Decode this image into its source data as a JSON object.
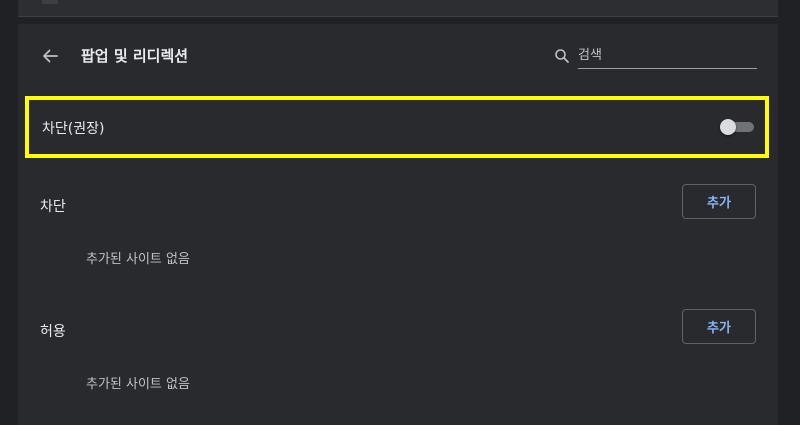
{
  "header": {
    "title": "팝업 및 리디렉션",
    "back_icon": "arrow-left-icon",
    "search": {
      "placeholder": "검색",
      "value": "",
      "icon": "search-icon"
    }
  },
  "block_setting": {
    "label": "차단(권장)",
    "toggle_on": false,
    "highlight_color": "#ffff00"
  },
  "sections": [
    {
      "label": "차단",
      "add_label": "추가",
      "empty_text": "추가된 사이트 없음"
    },
    {
      "label": "허용",
      "add_label": "추가",
      "empty_text": "추가된 사이트 없음"
    }
  ],
  "colors": {
    "background": "#202124",
    "panel": "#292a2d",
    "accent": "#8ab4f8"
  }
}
